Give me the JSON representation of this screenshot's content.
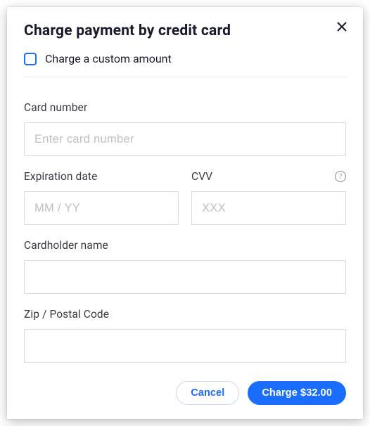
{
  "header": {
    "title": "Charge payment by credit card"
  },
  "customAmount": {
    "label": "Charge a custom amount"
  },
  "fields": {
    "cardNumber": {
      "label": "Card number",
      "placeholder": "Enter card number",
      "value": ""
    },
    "expiration": {
      "label": "Expiration date",
      "placeholder": "MM / YY",
      "value": ""
    },
    "cvv": {
      "label": "CVV",
      "placeholder": "XXX",
      "value": ""
    },
    "cardholder": {
      "label": "Cardholder name",
      "placeholder": "",
      "value": ""
    },
    "zip": {
      "label": "Zip / Postal Code",
      "placeholder": "",
      "value": ""
    }
  },
  "footer": {
    "cancel": "Cancel",
    "charge": "Charge $32.00"
  },
  "helpIcon": "?"
}
